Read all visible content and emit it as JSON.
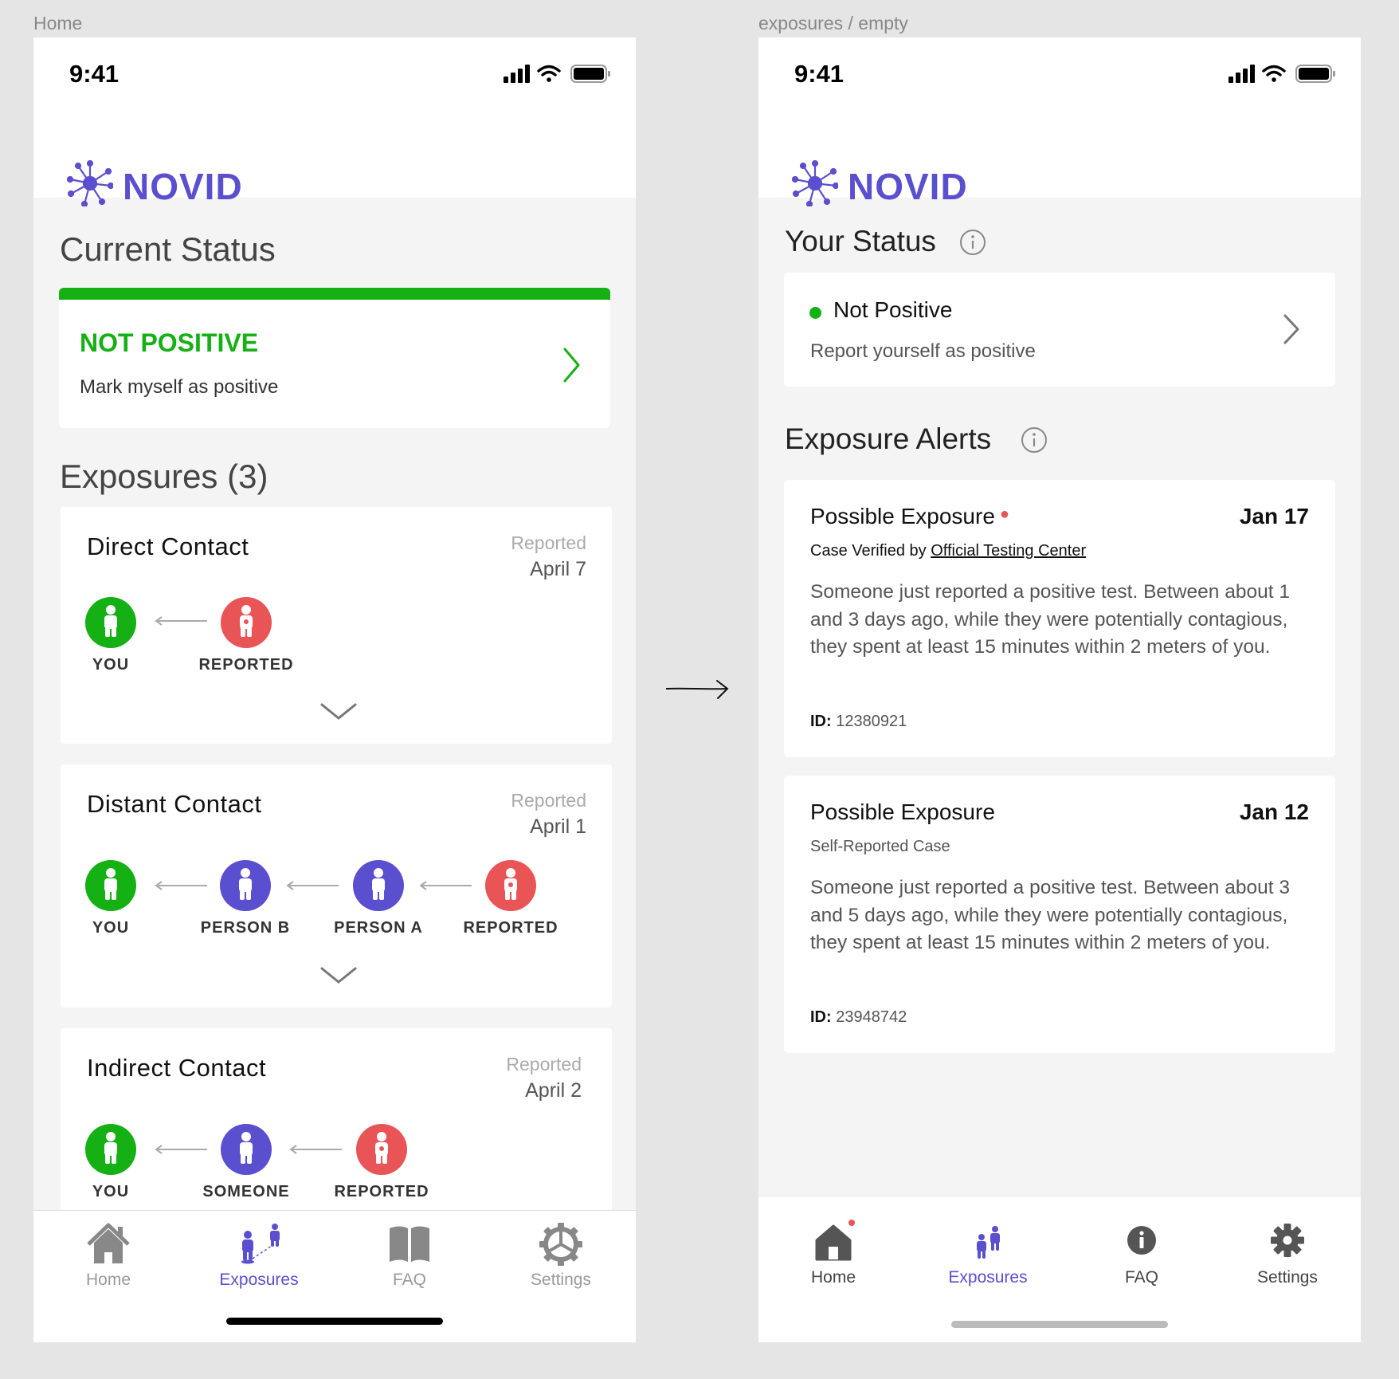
{
  "frames": {
    "left_label": "Home",
    "right_label": "exposures / empty"
  },
  "colors": {
    "brand": "#5a4fcf",
    "positive_status": "#14b014",
    "reported": "#e95456"
  },
  "phone_a": {
    "time": "9:41",
    "app_name": "NOVID",
    "current_status_title": "Current Status",
    "status_card": {
      "title": "NOT POSITIVE",
      "subtitle": "Mark myself as positive"
    },
    "exposures_title": "Exposures (3)",
    "exposures": [
      {
        "title": "Direct Contact",
        "reported_label": "Reported",
        "reported_date": "April 7",
        "chain": [
          {
            "label": "YOU",
            "kind": "you"
          },
          {
            "label": "REPORTED",
            "kind": "reported"
          }
        ]
      },
      {
        "title": "Distant Contact",
        "reported_label": "Reported",
        "reported_date": "April 1",
        "chain": [
          {
            "label": "YOU",
            "kind": "you"
          },
          {
            "label": "PERSON B",
            "kind": "person"
          },
          {
            "label": "PERSON A",
            "kind": "person"
          },
          {
            "label": "REPORTED",
            "kind": "reported"
          }
        ]
      },
      {
        "title": "Indirect Contact",
        "reported_label": "Reported",
        "reported_date": "April 2",
        "chain": [
          {
            "label": "YOU",
            "kind": "you"
          },
          {
            "label": "SOMEONE",
            "kind": "person"
          },
          {
            "label": "REPORTED",
            "kind": "reported"
          }
        ]
      }
    ],
    "tabs": [
      {
        "label": "Home",
        "icon": "house-icon"
      },
      {
        "label": "Exposures",
        "icon": "people-icon",
        "active": true
      },
      {
        "label": "FAQ",
        "icon": "book-icon"
      },
      {
        "label": "Settings",
        "icon": "gear-icon"
      }
    ]
  },
  "phone_b": {
    "time": "9:41",
    "app_name": "NOVID",
    "your_status_title": "Your Status",
    "status_card": {
      "title": "Not Positive",
      "subtitle": "Report yourself as positive"
    },
    "alerts_title": "Exposure Alerts",
    "alerts": [
      {
        "title": "Possible Exposure",
        "unread": true,
        "date": "Jan 17",
        "source_prefix": "Case Verified by ",
        "source_link": "Official Testing Center",
        "body": "Someone just reported a positive test. Between about 1 and 3 days ago, while they were potentially contagious, they spent at least 15 minutes within 2 meters of you.",
        "id_label": "ID:",
        "id_value": "12380921"
      },
      {
        "title": "Possible Exposure",
        "unread": false,
        "date": "Jan 12",
        "source_text": "Self-Reported Case",
        "body": "Someone just reported a positive test. Between about 3 and 5 days ago, while they were potentially contagious, they spent at least 15 minutes within 2 meters of you.",
        "id_label": "ID:",
        "id_value": "23948742"
      }
    ],
    "tabs": [
      {
        "label": "Home",
        "icon": "house-icon",
        "badge": true
      },
      {
        "label": "Exposures",
        "icon": "people-icon",
        "active": true
      },
      {
        "label": "FAQ",
        "icon": "info-icon"
      },
      {
        "label": "Settings",
        "icon": "gear-icon"
      }
    ]
  }
}
